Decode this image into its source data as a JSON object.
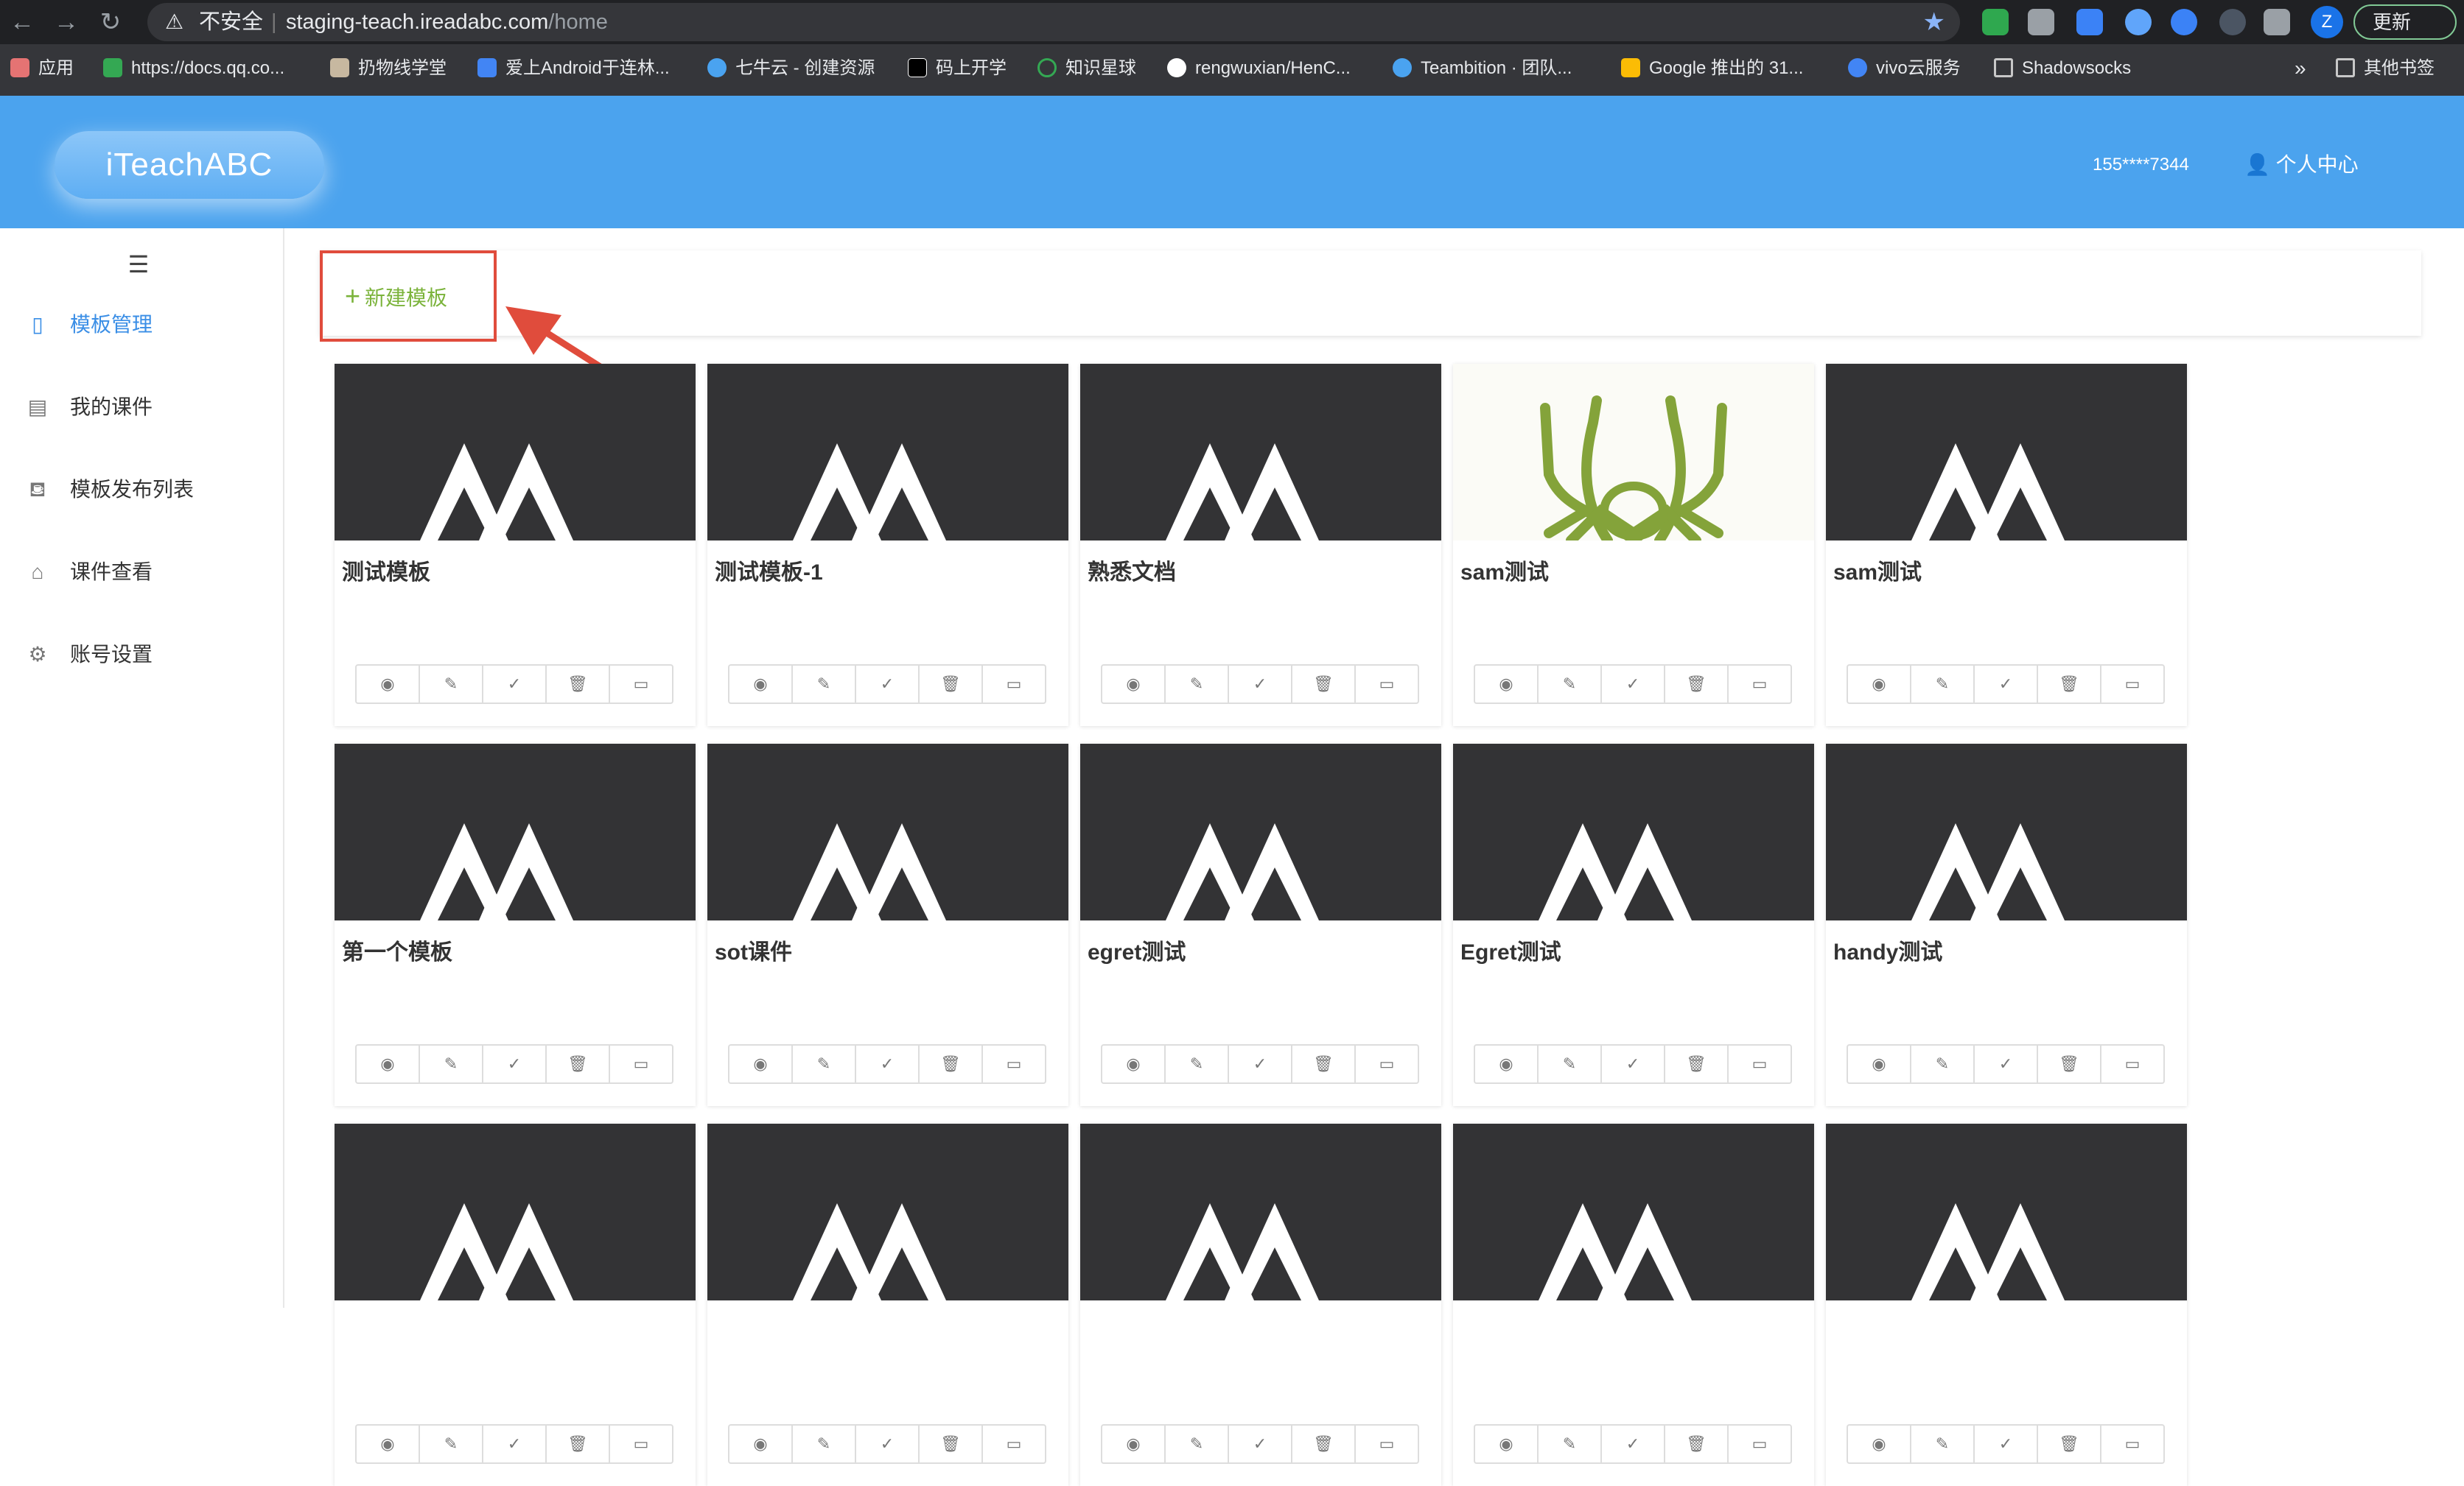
{
  "browser": {
    "security_label": "不安全",
    "url_host": "staging-teach.ireadabc.com",
    "url_path": "/home",
    "profile_initial": "Z",
    "update_label": "更新",
    "bookmarks": [
      "应用",
      "https://docs.qq.co...",
      "扔物线学堂",
      "爱上Android于连林...",
      "七牛云 - 创建资源",
      "码上开学",
      "知识星球",
      "rengwuxian/HenC...",
      "Teambition · 团队...",
      "Google 推出的 31...",
      "vivo云服务",
      "Shadowsocks"
    ],
    "bookmarks_more": "»",
    "other_bookmarks": "其他书签"
  },
  "header": {
    "logo": "iTeachABC",
    "phone": "155****7344",
    "user_center": "个人中心"
  },
  "sidebar": {
    "items": [
      {
        "label": "模板管理",
        "icon": "tablet-icon",
        "active": true
      },
      {
        "label": "我的课件",
        "icon": "document-icon",
        "active": false
      },
      {
        "label": "模板发布列表",
        "icon": "publish-icon",
        "active": false
      },
      {
        "label": "课件查看",
        "icon": "presentation-icon",
        "active": false
      },
      {
        "label": "账号设置",
        "icon": "gear-icon",
        "active": false
      }
    ]
  },
  "toolbar": {
    "new_template": "新建模板"
  },
  "colors": {
    "header": "#4ba3ee",
    "accent_active": "#3a8ee6",
    "new_button_text": "#7bb33b",
    "highlight": "#e04c3c"
  },
  "templates": [
    {
      "title": "测试模板",
      "thumb": "mountain"
    },
    {
      "title": "测试模板-1",
      "thumb": "mountain"
    },
    {
      "title": "熟悉文档",
      "thumb": "mountain"
    },
    {
      "title": "sam测试",
      "thumb": "spider"
    },
    {
      "title": "sam测试",
      "thumb": "mountain"
    },
    {
      "title": "第一个模板",
      "thumb": "mountain"
    },
    {
      "title": "sot课件",
      "thumb": "mountain"
    },
    {
      "title": "egret测试",
      "thumb": "mountain"
    },
    {
      "title": "Egret测试",
      "thumb": "mountain"
    },
    {
      "title": "handy测试",
      "thumb": "mountain"
    },
    {
      "title": "",
      "thumb": "mountain"
    },
    {
      "title": "",
      "thumb": "mountain"
    },
    {
      "title": "",
      "thumb": "mountain"
    },
    {
      "title": "",
      "thumb": "mountain"
    },
    {
      "title": "",
      "thumb": "mountain"
    }
  ],
  "card_actions": [
    {
      "icon": "play-icon",
      "glyph": "◉"
    },
    {
      "icon": "edit-icon",
      "glyph": "✎"
    },
    {
      "icon": "check-list-icon",
      "glyph": "✓"
    },
    {
      "icon": "trash-icon",
      "glyph": "🗑"
    },
    {
      "icon": "preview-icon",
      "glyph": "▭"
    }
  ]
}
